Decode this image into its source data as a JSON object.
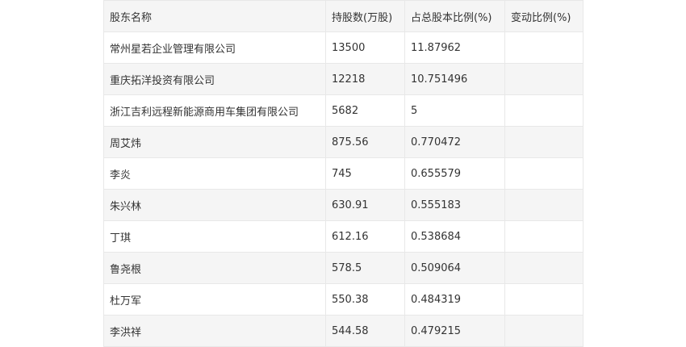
{
  "table": {
    "headers": [
      "股东名称",
      "持股数(万股)",
      "占总股本比例(%)",
      "变动比例(%)"
    ],
    "rows": [
      [
        "常州星若企业管理有限公司",
        "13500",
        "11.87962",
        ""
      ],
      [
        "重庆拓洋投资有限公司",
        "12218",
        "10.751496",
        ""
      ],
      [
        "浙江吉利远程新能源商用车集团有限公司",
        "5682",
        "5",
        ""
      ],
      [
        "周艾炜",
        "875.56",
        "0.770472",
        ""
      ],
      [
        "李炎",
        "745",
        "0.655579",
        ""
      ],
      [
        "朱兴林",
        "630.91",
        "0.555183",
        ""
      ],
      [
        "丁琪",
        "612.16",
        "0.538684",
        ""
      ],
      [
        "鲁尧根",
        "578.5",
        "0.509064",
        ""
      ],
      [
        "杜万军",
        "550.38",
        "0.484319",
        ""
      ],
      [
        "李洪祥",
        "544.58",
        "0.479215",
        ""
      ]
    ]
  }
}
